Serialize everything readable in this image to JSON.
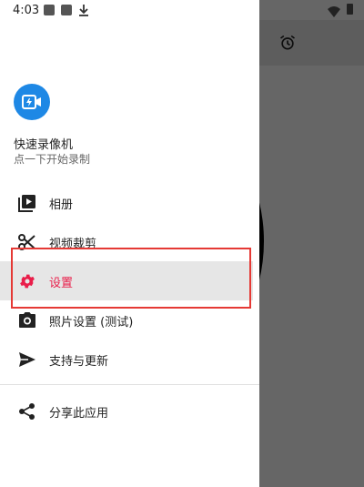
{
  "status_bar": {
    "time": "4:03"
  },
  "app": {
    "name": "快速录像机",
    "subtitle": "点一下开始录制"
  },
  "menu": {
    "items": [
      {
        "label": "相册",
        "icon": "play-library-icon"
      },
      {
        "label": "视频裁剪",
        "icon": "scissors-icon"
      },
      {
        "label": "设置",
        "icon": "gear-icon",
        "active": true
      },
      {
        "label": "照片设置 (测试)",
        "icon": "camera-icon"
      },
      {
        "label": "支持与更新",
        "icon": "send-icon"
      }
    ],
    "share": {
      "label": "分享此应用",
      "icon": "share-icon"
    }
  },
  "colors": {
    "accent": "#e91e4a",
    "logo": "#1e88e5",
    "highlight_border": "#e53935",
    "active_bg": "#e6e6e6"
  }
}
